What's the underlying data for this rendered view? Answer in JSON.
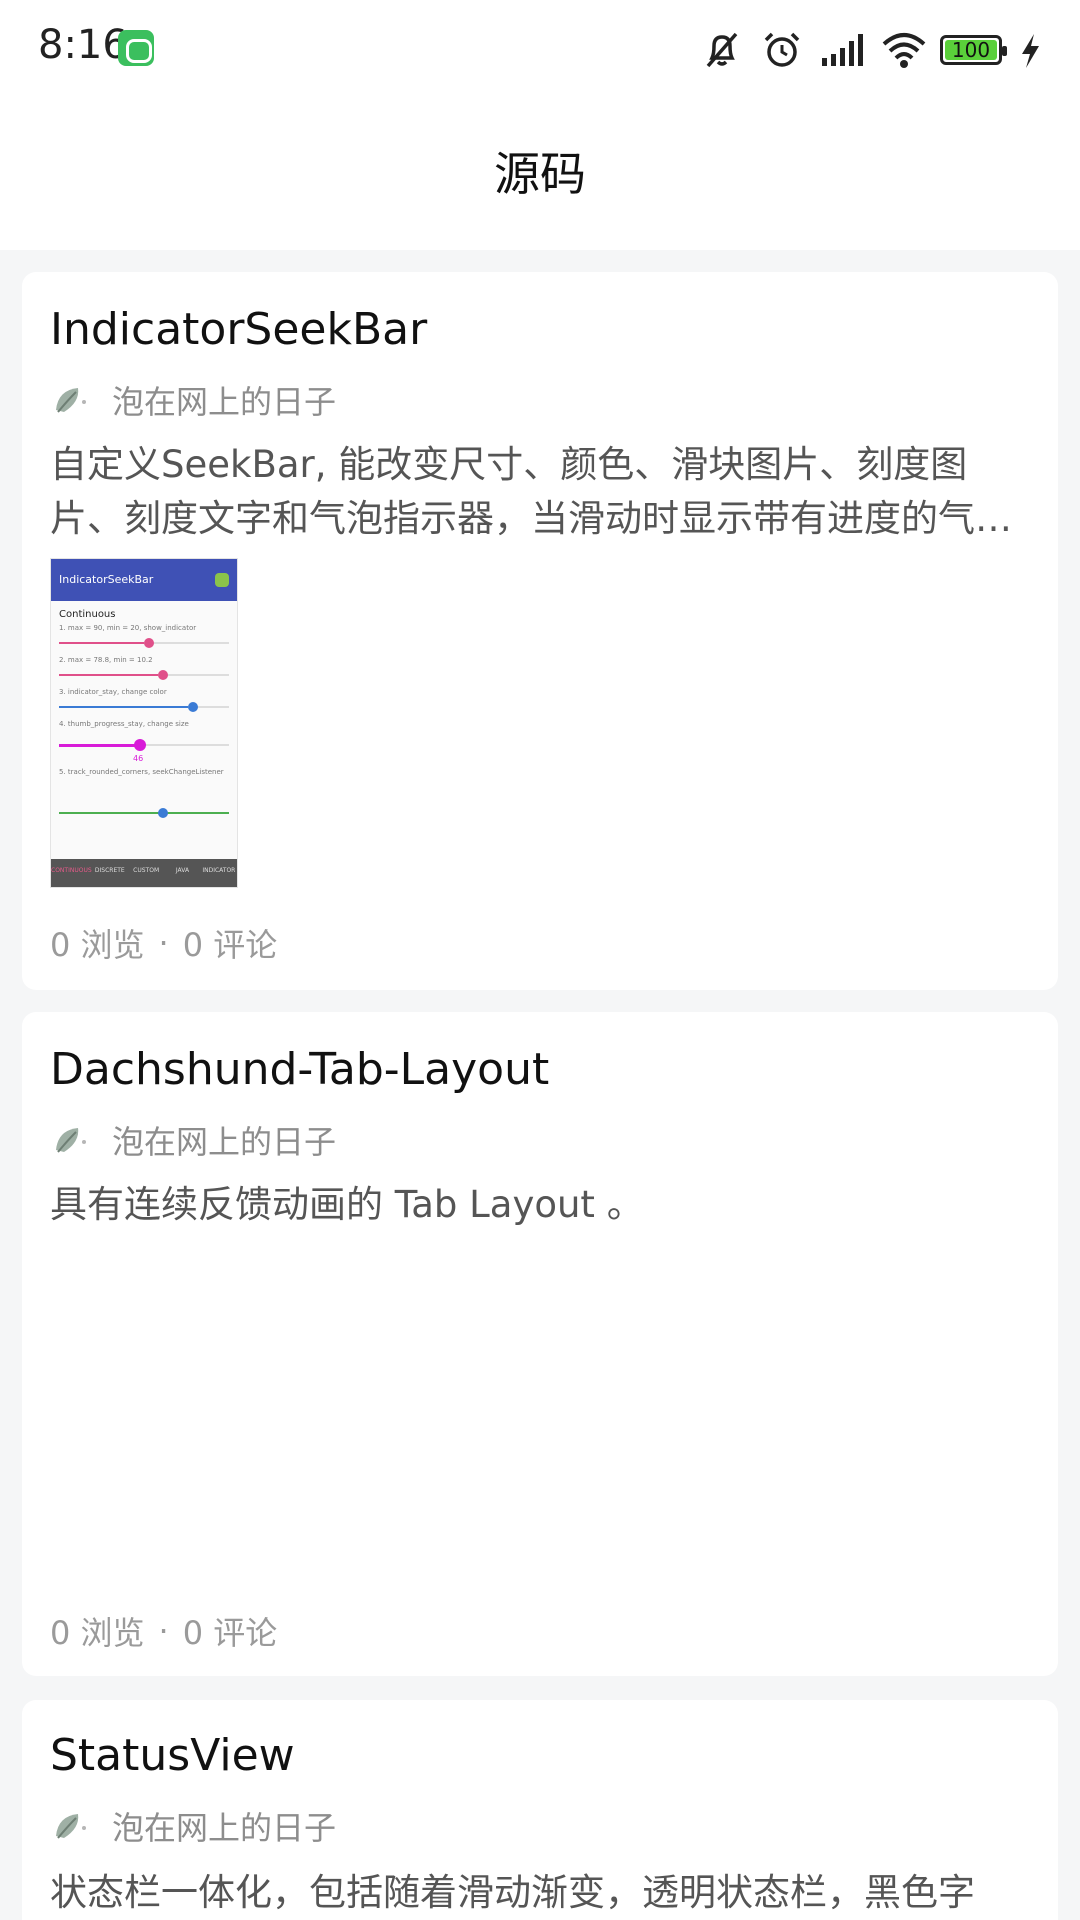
{
  "status_bar": {
    "time": "8:16",
    "icons": [
      "app-cat-icon",
      "mute-bell-icon",
      "alarm-icon",
      "signal-icon",
      "wifi-icon",
      "battery-icon",
      "charging-icon"
    ],
    "battery_level": "100"
  },
  "header": {
    "title": "源码"
  },
  "cards": [
    {
      "title": "IndicatorSeekBar",
      "author": "泡在网上的日子",
      "description": "自定义SeekBar, 能改变尺寸、颜色、滑块图片、刻度图片、刻度文字和气泡指示器，当滑动时显示带有进度的气泡指示器。",
      "thumbnail": {
        "app_title": "IndicatorSeekBar",
        "section": "Continuous",
        "rows": [
          "1. max = 90, min = 20, show_indicator",
          "2. max = 78.8, min = 10.2",
          "3. indicator_stay, change color",
          "4. thumb_progress_stay, change size",
          "5. track_rounded_corners, seekChangeListener"
        ],
        "value_46": "46",
        "tabs": [
          "CONTINUOUS",
          "DISCRETE",
          "CUSTOM",
          "JAVA",
          "INDICATOR"
        ]
      },
      "views": "0 浏览",
      "separator": "·",
      "comments": "0 评论"
    },
    {
      "title": "Dachshund-Tab-Layout",
      "author": "泡在网上的日子",
      "description": "具有连续反馈动画的 Tab Layout 。",
      "views": "0 浏览",
      "separator": "·",
      "comments": "0 评论"
    },
    {
      "title": "StatusView",
      "author": "泡在网上的日子",
      "description": "状态栏一体化，包括随着滑动渐变，透明状态栏，黑色字"
    }
  ],
  "colors": {
    "background": "#f5f6f7",
    "card": "#ffffff",
    "muted_text": "#9a9a9a",
    "thumb_header": "#3f51b5",
    "seek_pink": "#e0508a",
    "seek_blue": "#3a7bd5",
    "seek_magenta": "#d81bd8",
    "seek_green": "#4caf50"
  }
}
